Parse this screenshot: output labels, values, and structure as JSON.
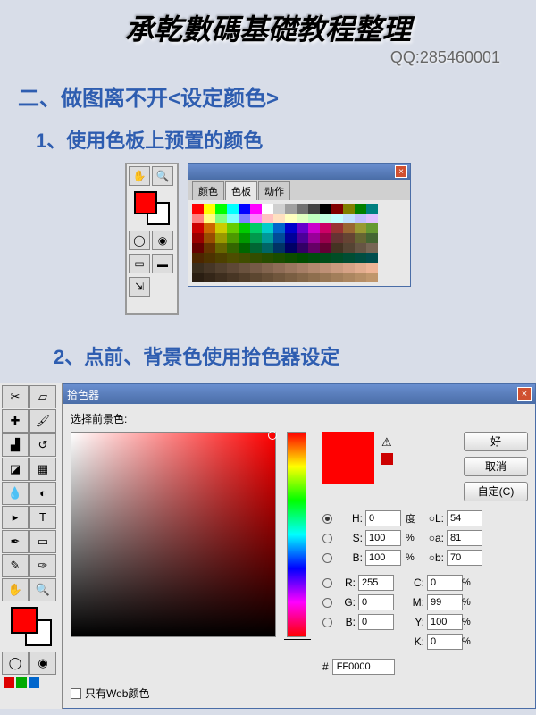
{
  "header": {
    "title": "承乾數碼基礎教程整理",
    "qq_label": "QQ:285460001"
  },
  "section2": {
    "title": "二、做图离不开<设定颜色>",
    "sub1": "1、使用色板上预置的颜色",
    "sub2": "2、点前、背景色使用拾色器设定"
  },
  "swatches": {
    "tabs": {
      "color": "颜色",
      "swatch": "色板",
      "action": "动作"
    },
    "close": "×"
  },
  "picker": {
    "title": "拾色器",
    "close": "×",
    "choose_label": "选择前景色:",
    "buttons": {
      "ok": "好",
      "cancel": "取消",
      "custom": "自定(C)"
    },
    "warn": "⚠",
    "labels": {
      "H": "H:",
      "S": "S:",
      "B": "B:",
      "L": "L:",
      "a": "a:",
      "b": "b:",
      "R": "R:",
      "G": "G:",
      "B2": "B:",
      "C": "C:",
      "M": "M:",
      "Y": "Y:",
      "K": "K:"
    },
    "values": {
      "H": "0",
      "S": "100",
      "Bv": "100",
      "L": "54",
      "a": "81",
      "b": "70",
      "R": "255",
      "G": "0",
      "B2": "0",
      "C": "0",
      "M": "99",
      "Y": "100",
      "K": "0"
    },
    "units": {
      "deg": "度",
      "pct": "%"
    },
    "hex_prefix": "#",
    "hex": "FF0000",
    "web_only": "只有Web颜色"
  },
  "swatch_colors": [
    "#ff0000",
    "#ffff00",
    "#00ff00",
    "#00ffff",
    "#0000ff",
    "#ff00ff",
    "#ffffff",
    "#d0d0d0",
    "#a0a0a0",
    "#707070",
    "#404040",
    "#000000",
    "#800000",
    "#808000",
    "#008000",
    "#008080",
    "#ff8080",
    "#ffff80",
    "#80ff80",
    "#80ffff",
    "#8080ff",
    "#ff80ff",
    "#ffc0c0",
    "#ffe0c0",
    "#ffffc0",
    "#e0ffc0",
    "#c0ffc0",
    "#c0ffe0",
    "#c0ffff",
    "#c0e0ff",
    "#c0c0ff",
    "#e0c0ff",
    "#cc0000",
    "#cc6600",
    "#cccc00",
    "#66cc00",
    "#00cc00",
    "#00cc66",
    "#00cccc",
    "#0066cc",
    "#0000cc",
    "#6600cc",
    "#cc00cc",
    "#cc0066",
    "#993333",
    "#996633",
    "#999933",
    "#669933",
    "#990000",
    "#994c00",
    "#999900",
    "#4c9900",
    "#009900",
    "#00994c",
    "#009999",
    "#004c99",
    "#000099",
    "#4c0099",
    "#990099",
    "#99004c",
    "#663333",
    "#664433",
    "#666633",
    "#446633",
    "#660000",
    "#663300",
    "#666600",
    "#336600",
    "#006600",
    "#006633",
    "#006666",
    "#003366",
    "#000066",
    "#330066",
    "#660066",
    "#660033",
    "#443322",
    "#554433",
    "#665544",
    "#776655",
    "#4d2600",
    "#4d3300",
    "#4d4000",
    "#4d4d00",
    "#404d00",
    "#334d00",
    "#264d00",
    "#1a4d00",
    "#0d4d00",
    "#004d00",
    "#004d0d",
    "#004d1a",
    "#004d26",
    "#004d33",
    "#004d40",
    "#004d4d",
    "#3a2e1e",
    "#463626",
    "#52402e",
    "#5e4836",
    "#6a523e",
    "#765a46",
    "#82644e",
    "#8e6c56",
    "#9a765e",
    "#a67e66",
    "#b2886e",
    "#be9076",
    "#ca9a7e",
    "#d6a286",
    "#e2ac8e",
    "#eeb496",
    "#2a1e12",
    "#342618",
    "#3e2e1e",
    "#483624",
    "#523e2a",
    "#5c4630",
    "#664e36",
    "#70563c",
    "#7a5e42",
    "#846648",
    "#8e6e4e",
    "#987654",
    "#a27e5a",
    "#ac8660",
    "#b68e66",
    "#c0966c"
  ]
}
